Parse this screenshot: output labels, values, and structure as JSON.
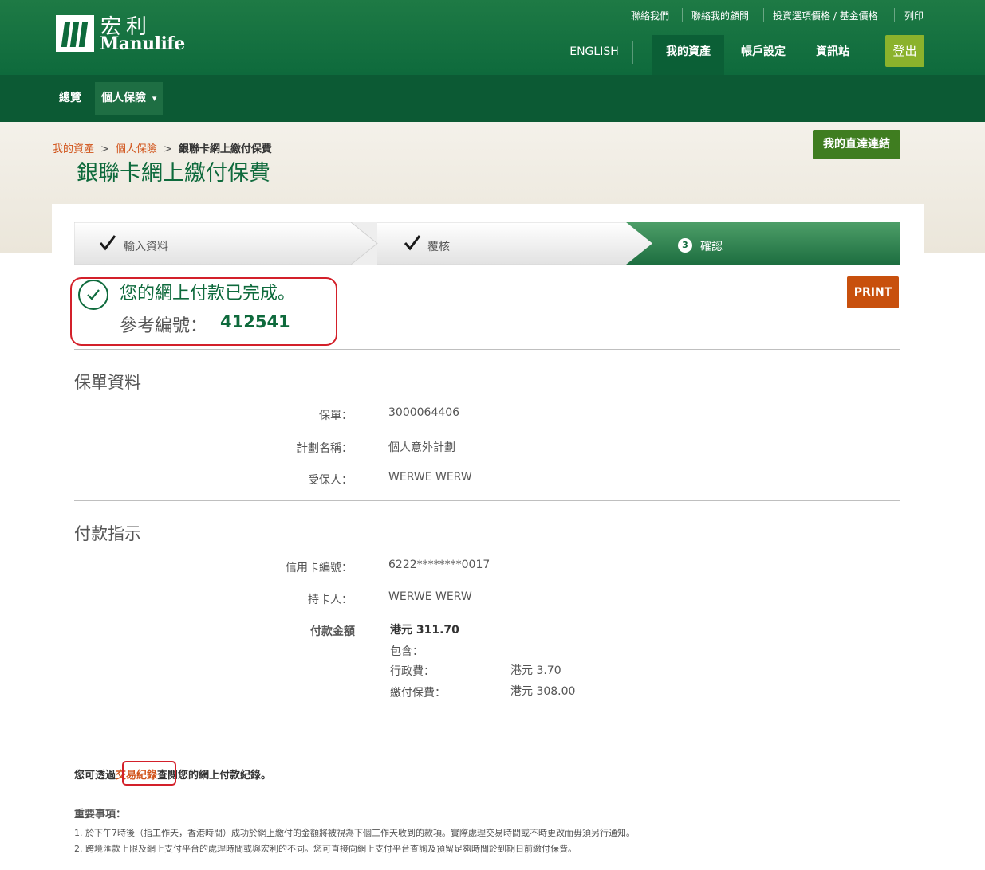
{
  "brand": {
    "name_cn": "宏利",
    "name_en": "Manulife"
  },
  "utility_nav": [
    "聯絡我們",
    "聯絡我的顧問",
    "投資選項價格 / 基金價格",
    "列印"
  ],
  "main_nav": {
    "language": "ENGLISH",
    "items": [
      "我的資產",
      "帳戶設定",
      "資訊站"
    ],
    "logout": "登出"
  },
  "sub_nav": {
    "items": [
      "總覽",
      "個人保險"
    ],
    "dropdown_icon": "▾"
  },
  "breadcrumb": {
    "items": [
      "我的資產",
      "個人保險"
    ],
    "current": "銀聯卡網上繳付保費",
    "separator": ">"
  },
  "page_title": "銀聯卡網上繳付保費",
  "quick_link_button": "我的直達連結",
  "steps": [
    {
      "label": "輸入資料",
      "status": "done"
    },
    {
      "label": "覆核",
      "status": "done"
    },
    {
      "number": "3",
      "label": "確認",
      "status": "current"
    }
  ],
  "confirmation": {
    "message": "您的網上付款已完成。",
    "ref_label": "參考編號：",
    "ref_number": "412541"
  },
  "print_button": "PRINT",
  "policy_section": {
    "title": "保單資料",
    "rows": [
      {
        "label": "保單：",
        "value": "3000064406"
      },
      {
        "label": "計劃名稱：",
        "value": "個人意外計劃"
      },
      {
        "label": "受保人：",
        "value": "WERWE WERW"
      }
    ]
  },
  "payment_section": {
    "title": "付款指示",
    "rows": [
      {
        "label": "信用卡編號：",
        "value": "6222********0017"
      },
      {
        "label": "持卡人：",
        "value": "WERWE WERW"
      }
    ],
    "amount_label": "付款金額",
    "amount_value": "港元 311.70",
    "includes_label": "包含：",
    "breakdown": [
      {
        "label": "行政費：",
        "value": "港元 3.70"
      },
      {
        "label": "繳付保費：",
        "value": "港元 308.00"
      }
    ]
  },
  "transaction_note": {
    "before": "您可透過",
    "link": "交易紀錄",
    "after": "查閱您的網上付款紀錄。"
  },
  "important": {
    "title": "重要事項：",
    "items": [
      "1.  於下午7時後（指工作天，香港時間）成功於網上繳付的金額將被視為下個工作天收到的款項。實際處理交易時間或不時更改而毋須另行通知。",
      "2.  跨境匯款上限及網上支付平台的處理時間或與宏利的不同。您可直接向網上支付平台查詢及預留足夠時間於到期日前繳付保費。"
    ]
  },
  "colors": {
    "brand_green": "#0e6a3c",
    "accent_orange": "#d1541b",
    "highlight_red": "#d3202a",
    "print_orange": "#c8500d",
    "logout_green": "#8bb22c"
  }
}
